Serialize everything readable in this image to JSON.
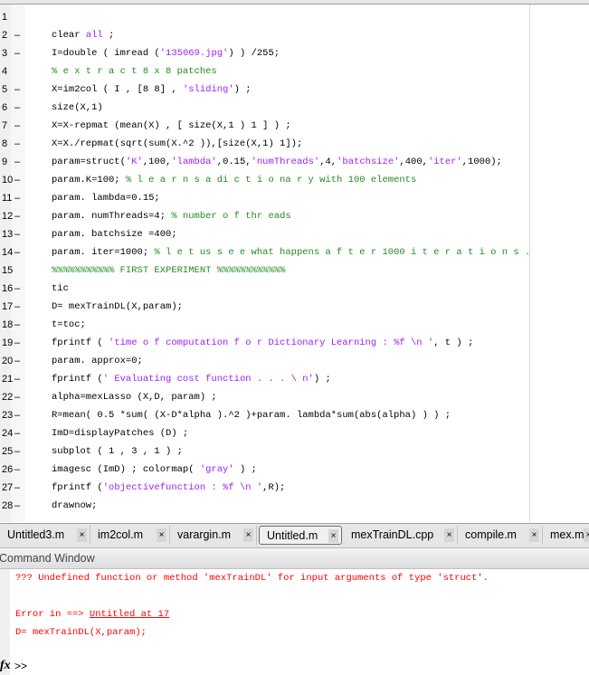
{
  "editor": {
    "lines": [
      {
        "n": "1",
        "dash": false,
        "segs": []
      },
      {
        "n": "2",
        "dash": true,
        "segs": [
          [
            "p",
            "clear "
          ],
          [
            "k",
            "all"
          ],
          [
            "p",
            " ;"
          ]
        ]
      },
      {
        "n": "3",
        "dash": true,
        "segs": [
          [
            "p",
            "I=double ( imread ("
          ],
          [
            "s",
            "'135069.jpg'"
          ],
          [
            "p",
            ") ) /255;"
          ]
        ]
      },
      {
        "n": "4",
        "dash": false,
        "segs": [
          [
            "c",
            "% e x t r a c t 8 x 8 patches"
          ]
        ]
      },
      {
        "n": "5",
        "dash": true,
        "segs": [
          [
            "p",
            "X=im2col ( I , [8 8] , "
          ],
          [
            "s",
            "'sliding'"
          ],
          [
            "p",
            ") ;"
          ]
        ]
      },
      {
        "n": "6",
        "dash": true,
        "segs": [
          [
            "p",
            "size(X,1)"
          ]
        ]
      },
      {
        "n": "7",
        "dash": true,
        "segs": [
          [
            "p",
            "X=X-repmat (mean(X) , [ size(X,1 ) 1 ] ) ;"
          ]
        ]
      },
      {
        "n": "8",
        "dash": true,
        "segs": [
          [
            "p",
            "X=X./repmat(sqrt(sum(X.^2 )),[size(X,1) 1]);"
          ]
        ]
      },
      {
        "n": "9",
        "dash": true,
        "segs": [
          [
            "p",
            "param=struct("
          ],
          [
            "s",
            "'K'"
          ],
          [
            "p",
            ",100,"
          ],
          [
            "s",
            "'lambda'"
          ],
          [
            "p",
            ",0.15,"
          ],
          [
            "s",
            "'numThreads'"
          ],
          [
            "p",
            ",4,"
          ],
          [
            "s",
            "'batchsize'"
          ],
          [
            "p",
            ",400,"
          ],
          [
            "s",
            "'iter'"
          ],
          [
            "p",
            ",1000);"
          ]
        ]
      },
      {
        "n": "10",
        "dash": true,
        "segs": [
          [
            "p",
            "param.K=100; "
          ],
          [
            "c",
            "% l e a r n s a di c t i o na r y with 100 elements"
          ]
        ]
      },
      {
        "n": "11",
        "dash": true,
        "segs": [
          [
            "p",
            "param. lambda=0.15;"
          ]
        ]
      },
      {
        "n": "12",
        "dash": true,
        "segs": [
          [
            "p",
            "param. numThreads=4; "
          ],
          [
            "c",
            "% number o f thr eads"
          ]
        ]
      },
      {
        "n": "13",
        "dash": true,
        "segs": [
          [
            "p",
            "param. batchsize =400;"
          ]
        ]
      },
      {
        "n": "14",
        "dash": true,
        "segs": [
          [
            "p",
            "param. iter=1000; "
          ],
          [
            "c",
            "% l e t us s e e what happens a f t e r 1000 i t e r a t i o n s ."
          ]
        ]
      },
      {
        "n": "15",
        "dash": false,
        "segs": [
          [
            "c",
            "%%%%%%%%%%% FIRST EXPERIMENT %%%%%%%%%%%%"
          ]
        ]
      },
      {
        "n": "16",
        "dash": true,
        "segs": [
          [
            "p",
            "tic"
          ]
        ]
      },
      {
        "n": "17",
        "dash": true,
        "segs": [
          [
            "p",
            "D= mexTrainDL(X,param);"
          ]
        ]
      },
      {
        "n": "18",
        "dash": true,
        "segs": [
          [
            "p",
            "t=toc;"
          ]
        ]
      },
      {
        "n": "19",
        "dash": true,
        "segs": [
          [
            "p",
            "fprintf ( "
          ],
          [
            "s",
            "'time o f computation f o r Dictionary Learning : %f \\n '"
          ],
          [
            "p",
            ", t ) ;"
          ]
        ]
      },
      {
        "n": "20",
        "dash": true,
        "segs": [
          [
            "p",
            "param. approx=0;"
          ]
        ]
      },
      {
        "n": "21",
        "dash": true,
        "segs": [
          [
            "p",
            "fprintf ("
          ],
          [
            "s",
            "' Evaluating cost function . . . \\ n'"
          ],
          [
            "p",
            ") ;"
          ]
        ]
      },
      {
        "n": "22",
        "dash": true,
        "segs": [
          [
            "p",
            "alpha=mexLasso (X,D, param) ;"
          ]
        ]
      },
      {
        "n": "23",
        "dash": true,
        "segs": [
          [
            "p",
            "R=mean( 0.5 *sum( (X-D*alpha ).^2 )+param. lambda*sum(abs(alpha) ) ) ;"
          ]
        ]
      },
      {
        "n": "24",
        "dash": true,
        "segs": [
          [
            "p",
            "ImD=displayPatches (D) ;"
          ]
        ]
      },
      {
        "n": "25",
        "dash": true,
        "segs": [
          [
            "p",
            "subplot ( 1 , 3 , 1 ) ;"
          ]
        ]
      },
      {
        "n": "26",
        "dash": true,
        "segs": [
          [
            "p",
            "imagesc (ImD) ; colormap( "
          ],
          [
            "s",
            "'gray'"
          ],
          [
            "p",
            " ) ;"
          ]
        ]
      },
      {
        "n": "27",
        "dash": true,
        "segs": [
          [
            "p",
            "fprintf ("
          ],
          [
            "s",
            "'objectivefunction : %f \\n '"
          ],
          [
            "p",
            ",R);"
          ]
        ]
      },
      {
        "n": "28",
        "dash": true,
        "segs": [
          [
            "p",
            "drawnow;"
          ]
        ]
      }
    ]
  },
  "tabs": [
    {
      "label": "Untitled3.m",
      "active": false
    },
    {
      "label": "im2col.m",
      "active": false
    },
    {
      "label": "varargin.m",
      "active": false
    },
    {
      "label": "Untitled.m",
      "active": true
    },
    {
      "label": "mexTrainDL.cpp",
      "active": false
    },
    {
      "label": "compile.m",
      "active": false
    },
    {
      "label": "mex.m",
      "active": false
    }
  ],
  "tab_close": "×",
  "command_window": {
    "title": "Command Window",
    "error_line": "??? Undefined function or method 'mexTrainDL' for input arguments of type 'struct'.",
    "error_in_prefix": "Error in ==> ",
    "error_in_link": "Untitled at 17",
    "error_code": "D= mexTrainDL(X,param);",
    "fx": "fx",
    "prompt": ">>"
  },
  "colors": {
    "keyword": "#a020f0",
    "string": "#a020f0",
    "comment": "#228b22",
    "error": "#ff0000"
  }
}
